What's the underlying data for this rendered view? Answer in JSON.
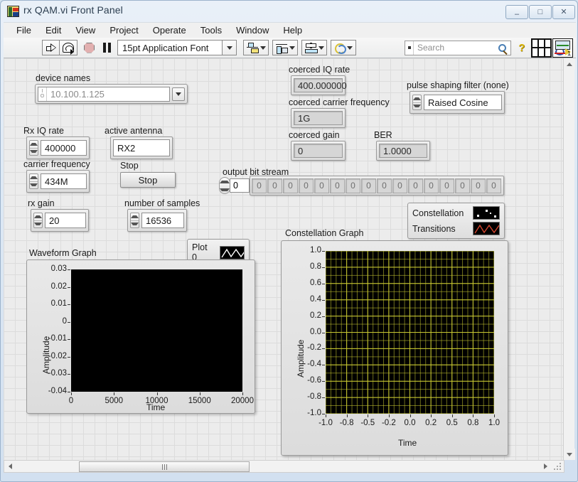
{
  "window": {
    "title": "rx QAM.vi Front Panel",
    "buttons": {
      "minimize": "–",
      "maximize": "□",
      "close": "✕"
    }
  },
  "menu": {
    "items": [
      "File",
      "Edit",
      "View",
      "Project",
      "Operate",
      "Tools",
      "Window",
      "Help"
    ]
  },
  "toolbar": {
    "font_selector": "15pt Application Font",
    "search_placeholder": "Search",
    "vi_icon_number": "1",
    "icons": [
      "run-arrow-icon",
      "run-continuously-icon",
      "abort-execution-icon",
      "pause-icon",
      "align-objects-icon",
      "distribute-objects-icon",
      "resize-objects-icon",
      "reorder-icon",
      "search-icon",
      "context-help-icon",
      "connector-pane-icon",
      "vi-icon"
    ]
  },
  "controls": {
    "device_names": {
      "label": "device names",
      "value": "10.100.1.125"
    },
    "rx_iq_rate": {
      "label": "Rx IQ rate",
      "value": "400000"
    },
    "carrier_frequency": {
      "label": "carrier frequency",
      "value": "434M"
    },
    "rx_gain": {
      "label": "rx gain",
      "value": "20"
    },
    "active_antenna": {
      "label": "active antenna",
      "value": "RX2"
    },
    "stop": {
      "label": "Stop",
      "button_label": "Stop"
    },
    "number_of_samples": {
      "label": "number of samples",
      "value": "16536"
    },
    "coerced_iq_rate": {
      "label": "coerced IQ rate",
      "value": "400.000000"
    },
    "coerced_carrier_frequency": {
      "label": "coerced carrier frequency",
      "value": "1G"
    },
    "coerced_gain": {
      "label": "coerced gain",
      "value": "0"
    },
    "ber": {
      "label": "BER",
      "value": "1.0000"
    },
    "pulse_shaping_filter": {
      "label": "pulse shaping filter (none)",
      "value": "Raised Cosine"
    },
    "output_bit_stream": {
      "label": "output bit stream",
      "index": "0",
      "cells": [
        "0",
        "0",
        "0",
        "0",
        "0",
        "0",
        "0",
        "0",
        "0",
        "0",
        "0",
        "0",
        "0",
        "0",
        "0",
        "0"
      ]
    }
  },
  "legends": {
    "waveform": {
      "rows": [
        {
          "name": "Plot 0",
          "color": "#ffffff",
          "style": "zigzag"
        }
      ]
    },
    "constellation": {
      "rows": [
        {
          "name": "Constellation",
          "color": "#ffffff",
          "style": "points"
        },
        {
          "name": "Transitions",
          "color": "#d4452e",
          "style": "zigzag"
        }
      ]
    }
  },
  "chart_data": [
    {
      "type": "line",
      "title": "Waveform Graph",
      "xlabel": "Time",
      "ylabel": "Amplitude",
      "xticks": [
        "0",
        "5000",
        "10000",
        "15000",
        "20000"
      ],
      "yticks": [
        "0.03",
        "0.02",
        "0.01",
        "0",
        "-0.01",
        "-0.02",
        "-0.03",
        "-0.04"
      ],
      "xlim": [
        0,
        20000
      ],
      "ylim": [
        -0.04,
        0.03
      ],
      "grid": false,
      "plot_background": "#000000",
      "series": [
        {
          "name": "Plot 0",
          "color": "#ffffff",
          "values": []
        }
      ]
    },
    {
      "type": "scatter",
      "title": "Constellation Graph",
      "xlabel": "Time",
      "ylabel": "Amplitude",
      "xticks": [
        "-1.0",
        "-0.8",
        "-0.5",
        "-0.2",
        "0.0",
        "0.2",
        "0.5",
        "0.8",
        "1.0"
      ],
      "yticks": [
        "1.0",
        "0.8",
        "0.6",
        "0.4",
        "0.2",
        "0.0",
        "-0.2",
        "-0.4",
        "-0.6",
        "-0.8",
        "-1.0"
      ],
      "xlim": [
        -1.0,
        1.0
      ],
      "ylim": [
        -1.0,
        1.0
      ],
      "grid": true,
      "grid_color": "#c8c832",
      "plot_background": "#000000",
      "series": [
        {
          "name": "Constellation",
          "color": "#ffffff",
          "values": []
        },
        {
          "name": "Transitions",
          "color": "#d4452e",
          "values": []
        }
      ]
    }
  ]
}
